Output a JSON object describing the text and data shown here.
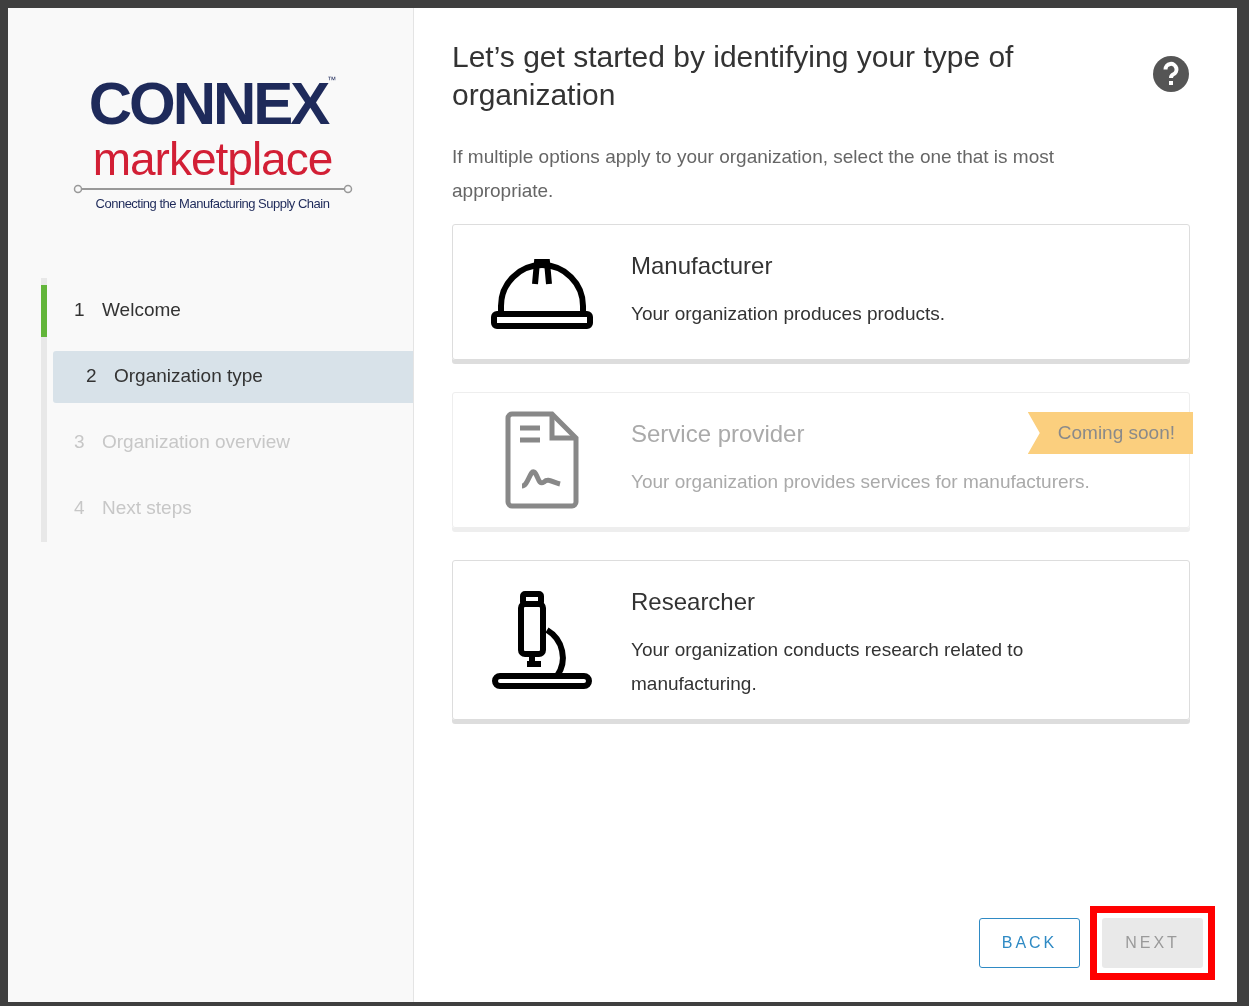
{
  "logo": {
    "name": "CONNEX",
    "trademark": "™",
    "subtitle": "marketplace",
    "tagline": "Connecting the Manufacturing Supply Chain"
  },
  "steps": [
    {
      "number": "1",
      "label": "Welcome",
      "selected": false,
      "completed": true,
      "disabled": false
    },
    {
      "number": "2",
      "label": "Organization type",
      "selected": true,
      "completed": false,
      "disabled": false
    },
    {
      "number": "3",
      "label": "Organization overview",
      "selected": false,
      "completed": false,
      "disabled": true
    },
    {
      "number": "4",
      "label": "Next steps",
      "selected": false,
      "completed": false,
      "disabled": true
    }
  ],
  "heading": "Let’s get started by identifying your type of organization",
  "intro": "If multiple options apply to your organization, select the one that is most appropriate.",
  "options": [
    {
      "kind": "helmet",
      "title": "Manufacturer",
      "description": "Your organization produces products.",
      "disabled": false
    },
    {
      "kind": "document",
      "title": "Service provider",
      "description": "Your organization provides services for manufacturers.",
      "disabled": true,
      "badge": "Coming soon!"
    },
    {
      "kind": "microscope",
      "title": "Researcher",
      "description": "Your organization conducts research related to manufacturing.",
      "disabled": false
    }
  ],
  "buttons": [
    {
      "kind": "outline",
      "label": "BACK",
      "disabled": false,
      "highlighted": false
    },
    {
      "kind": "solid",
      "label": "NEXT",
      "disabled": true,
      "highlighted": true
    }
  ]
}
